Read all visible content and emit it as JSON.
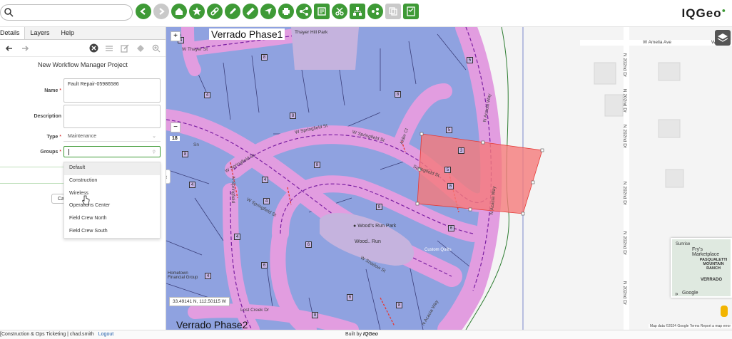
{
  "toolbar": {
    "search_placeholder": "",
    "logo": "IQGeo",
    "tools": [
      "back-icon",
      "forward-icon",
      "home-icon",
      "star-icon",
      "link-icon",
      "pencil-icon",
      "ruler-icon",
      "navigate-icon",
      "print-icon",
      "share-icon",
      "workflow-icon",
      "scissors-icon",
      "network-icon",
      "connect-icon",
      "copy-icon",
      "notes-icon"
    ]
  },
  "panel": {
    "tabs": [
      "Details",
      "Layers",
      "Help"
    ],
    "title": "New Workflow Manager Project",
    "name_label": "Name",
    "name_value": "Fault Repair-05986586",
    "description_label": "Description",
    "description_value": "",
    "type_label": "Type",
    "type_value": "Maintenance",
    "groups_label": "Groups",
    "groups_value": "",
    "required_mark": "*",
    "cancel_label": "Ca",
    "group_options": [
      "Default",
      "Construction",
      "Wireless",
      "Operations Center",
      "Field Crew North",
      "Field Crew South"
    ],
    "highlighted_option": "Default"
  },
  "map": {
    "phase1_label": "Verrado Phase1",
    "phase2_label": "Verrado Phase2",
    "coords": "33.49141 N, 112.50115 W",
    "zoom_in": "+",
    "zoom_out": "−",
    "zoom_level": "18",
    "collapse_glyph": "‹",
    "streets": {
      "springfield_1": "W Springfield St",
      "springfield_2": "W Springfield St",
      "springfield_3": "W Springfield St",
      "springfield_4": "W Springfield St",
      "springfield_5": "Springfield St",
      "thayer": "W Thayer St",
      "shadow": "W Shadow St",
      "lost_creek": "Lost Creek Dr",
      "amelia": "W Amelia Ave",
      "acacia_1": "N Acacia Way",
      "acacia_2": "N Acacia Way",
      "acacia_3": "N Acacia Way",
      "springfield_n": "N Springfield",
      "ave_202_1": "N 202nd Dr",
      "ave_202_2": "N 202nd Dr",
      "ave_202_3": "N 202nd Dr",
      "ave_202_4": "N 202nd Dr",
      "ave_202_5": "N 202nd Dr",
      "ave_202_6": "N 202nd Dr",
      "amelia_2": "W Amel",
      "glacier": "Sn",
      "eagle_way": "Alder Ct"
    },
    "places": {
      "thayer_park": "Thayer Hill Park",
      "woods_run_park": "Wood's Run Park",
      "woods_run_2": "Wood.. Run",
      "custom_quilts": "Custom Quilts",
      "hometown": "Hometown Financial Group"
    },
    "lot_numbers": [
      "4",
      "8",
      "5",
      "4",
      "8",
      "8",
      "8",
      "4",
      "8",
      "5",
      "3",
      "4",
      "6",
      "8",
      "6",
      "4",
      "6",
      "6",
      "6",
      "8",
      "4",
      "5",
      "4",
      "8"
    ],
    "minimap": {
      "frys": "Fry's Marketplace",
      "pasqualetti": "PASQUALETTI MOUNTAIN RANCH",
      "verrado": "VERRADO",
      "sunrise": "Sunrise",
      "google": "Google"
    },
    "attribution": "Map data ©2024 Google   Terms   Report a map error",
    "colors": {
      "parcel_fill": "#8fa2e0",
      "easement": "#e29de0",
      "selection": "#f57a7a",
      "accent": "#3e9a36"
    }
  },
  "status": {
    "context": "[Construction & Ops Ticketing | chad.smith",
    "logout": "Logout",
    "built_by": "Built by",
    "built_by_brand": "IQGeo"
  }
}
